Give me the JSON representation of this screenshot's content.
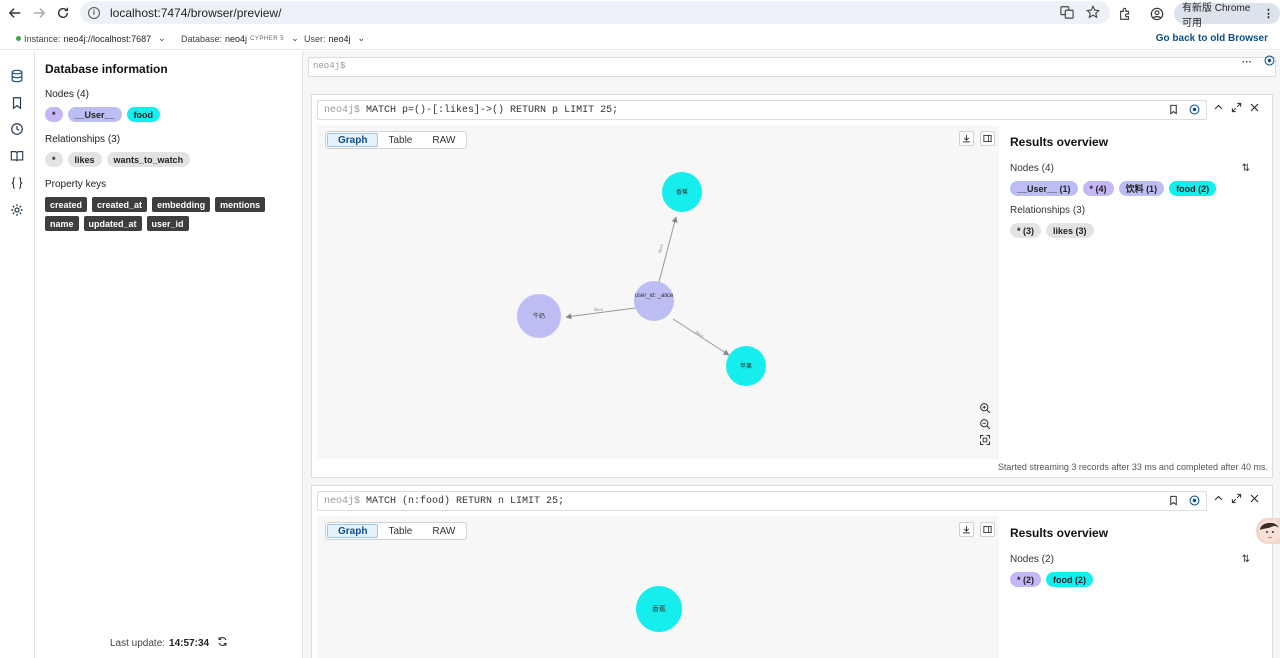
{
  "browser": {
    "url": "localhost:7474/browser/preview/",
    "update_label": "有新版 Chrome 可用"
  },
  "topbar": {
    "instance_label": "Instance:",
    "instance_value": "neo4j://localhost:7687",
    "database_label": "Database:",
    "database_value": "neo4j",
    "database_tag": "CYPHER 5",
    "user_label": "User:",
    "user_value": "neo4j",
    "go_back": "Go back to old Browser"
  },
  "db_info": {
    "title": "Database information",
    "nodes_header": "Nodes (4)",
    "nodes": [
      "*",
      "__User__",
      "food"
    ],
    "relationships_header": "Relationships (3)",
    "relationships": [
      "*",
      "likes",
      "wants_to_watch"
    ],
    "property_header": "Property keys",
    "property_keys": [
      "created",
      "created_at",
      "embedding",
      "mentions",
      "name",
      "updated_at",
      "user_id"
    ],
    "last_update_label": "Last update:",
    "last_update_time": "14:57:34"
  },
  "editor": {
    "prompt": "neo4j$"
  },
  "colors": {
    "user_node": "#bcbef3",
    "food_node": "#16eeee",
    "star_node": "#c5b6f5"
  },
  "frames": [
    {
      "prompt": "neo4j$",
      "query": "MATCH p=()-[:likes]->() RETURN p LIMIT 25;",
      "tabs": [
        "Graph",
        "Table",
        "RAW"
      ],
      "graph": {
        "nodes": [
          "user_id: _alice",
          "香蕉",
          "牛奶",
          "苹果"
        ],
        "edges": [
          "likes",
          "likes",
          "likes"
        ]
      },
      "results_title": "Results overview",
      "nodes_header": "Nodes (4)",
      "node_chips": [
        "__User__ (1)",
        "* (4)",
        "饮料 (1)",
        "food (2)"
      ],
      "rel_header": "Relationships (3)",
      "rel_chips": [
        "* (3)",
        "likes (3)"
      ],
      "status": "Started streaming 3 records after 33 ms and completed after 40 ms."
    },
    {
      "prompt": "neo4j$",
      "query": "MATCH (n:food) RETURN n LIMIT 25;",
      "tabs": [
        "Graph",
        "Table",
        "RAW"
      ],
      "graph": {
        "nodes": [
          "香蕉"
        ]
      },
      "results_title": "Results overview",
      "nodes_header": "Nodes (2)",
      "node_chips": [
        "* (2)",
        "food (2)"
      ]
    }
  ]
}
